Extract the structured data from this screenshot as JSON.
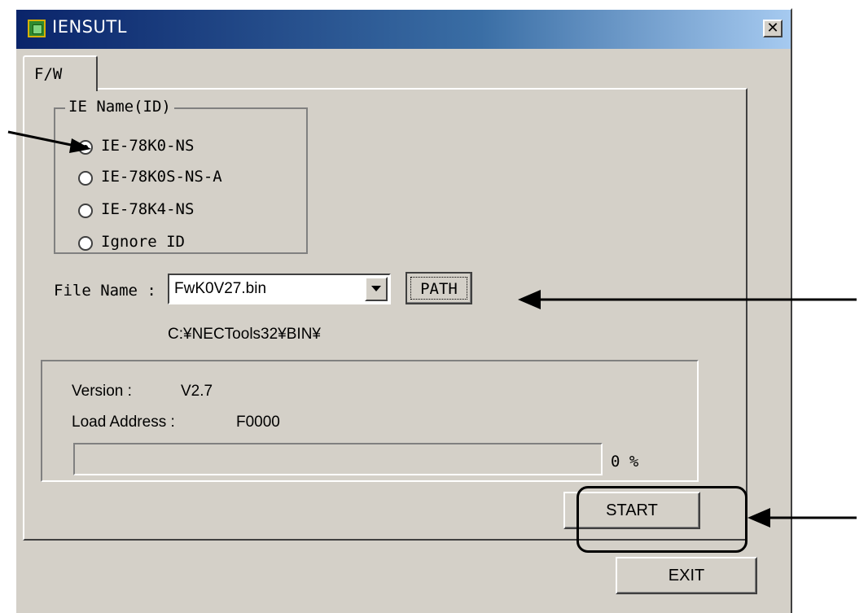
{
  "window": {
    "title": "IENSUTL",
    "close_label": "✕"
  },
  "tabs": [
    {
      "label": "F/W",
      "selected": true
    }
  ],
  "ie_group": {
    "title": "IE Name(ID)",
    "options": [
      {
        "label": "IE-78K0-NS",
        "checked": true
      },
      {
        "label": "IE-78K0S-NS-A",
        "checked": false
      },
      {
        "label": "IE-78K4-NS",
        "checked": false
      },
      {
        "label": "Ignore ID",
        "checked": false
      }
    ]
  },
  "file": {
    "label": "File Name :",
    "selected": "FwK0V27.bin",
    "path_button": "PATH",
    "path_text": "C:¥NECTools32¥BIN¥"
  },
  "info": {
    "version_label": "Version :",
    "version_value": "V2.7",
    "load_address_label": "Load Address :",
    "load_address_value": "F0000",
    "progress_text": "0 %",
    "progress_fraction": 0
  },
  "buttons": {
    "start": "START",
    "exit": "EXIT"
  },
  "colors": {
    "face": "#d4d0c8",
    "title_start": "#0a246a",
    "title_end": "#a6caf0"
  }
}
